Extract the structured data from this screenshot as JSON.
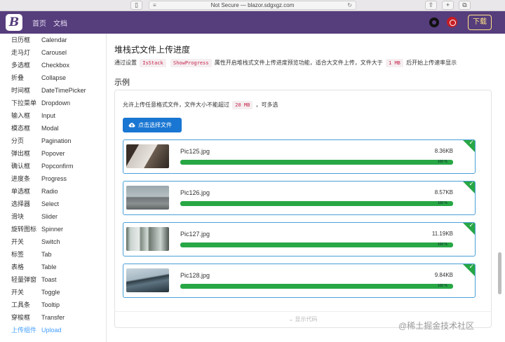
{
  "browser": {
    "url_text": "Not Secure — blazor.sdgxgz.com",
    "reload_glyph": "↻",
    "menu_glyph": "≡"
  },
  "header": {
    "logo_letter": "B",
    "nav": [
      "首页",
      "文档"
    ],
    "download_label": "下载"
  },
  "sidebar": {
    "items": [
      {
        "zh": "日历框",
        "en": "Calendar"
      },
      {
        "zh": "走马灯",
        "en": "Carousel"
      },
      {
        "zh": "多选框",
        "en": "Checkbox"
      },
      {
        "zh": "折叠",
        "en": "Collapse"
      },
      {
        "zh": "时间框",
        "en": "DateTimePicker"
      },
      {
        "zh": "下拉菜单",
        "en": "Dropdown"
      },
      {
        "zh": "输入框",
        "en": "Input"
      },
      {
        "zh": "模态框",
        "en": "Modal"
      },
      {
        "zh": "分页",
        "en": "Pagination"
      },
      {
        "zh": "弹出框",
        "en": "Popover"
      },
      {
        "zh": "确认框",
        "en": "Popconfirm"
      },
      {
        "zh": "进度条",
        "en": "Progress"
      },
      {
        "zh": "单选框",
        "en": "Radio"
      },
      {
        "zh": "选择器",
        "en": "Select"
      },
      {
        "zh": "滑块",
        "en": "Slider"
      },
      {
        "zh": "旋转图标",
        "en": "Spinner"
      },
      {
        "zh": "开关",
        "en": "Switch"
      },
      {
        "zh": "标签",
        "en": "Tab"
      },
      {
        "zh": "表格",
        "en": "Table"
      },
      {
        "zh": "轻量弹窗",
        "en": "Toast"
      },
      {
        "zh": "开关",
        "en": "Toggle"
      },
      {
        "zh": "工具条",
        "en": "Tooltip"
      },
      {
        "zh": "穿梭框",
        "en": "Transfer"
      },
      {
        "zh": "上传组件",
        "en": "Upload"
      }
    ],
    "active_index": 23
  },
  "main": {
    "title": "堆栈式文件上传进度",
    "desc_prefix": "通过设置",
    "code1": "IsStack",
    "code2": "ShowProgress",
    "desc_mid": "属性开启堆栈式文件上传进度预览功能，适合大文件上传，文件大于",
    "code3": "1 MB",
    "desc_suffix": "后开始上传速率显示",
    "section_title": "示例",
    "demo_desc_prefix": "允许上传任意格式文件，文件大小不能超过",
    "demo_code": "20 MB",
    "demo_desc_suffix": "，可多选",
    "upload_button": "点击选择文件",
    "show_code": "显示代码"
  },
  "files": [
    {
      "name": "Pic125.jpg",
      "size": "8.36KB",
      "progress": 100,
      "progress_text": "100 %",
      "thumb": "laptop"
    },
    {
      "name": "Pic126.jpg",
      "size": "8.57KB",
      "progress": 100,
      "progress_text": "100 %",
      "thumb": "pier"
    },
    {
      "name": "Pic127.jpg",
      "size": "11.19KB",
      "progress": 100,
      "progress_text": "100 %",
      "thumb": "window"
    },
    {
      "name": "Pic128.jpg",
      "size": "9.84KB",
      "progress": 100,
      "progress_text": "100 %",
      "thumb": "coast"
    }
  ],
  "watermark": "@稀土掘金技术社区",
  "colors": {
    "header_bg": "#563d7c",
    "active_link": "#409eff",
    "primary_button": "#1976d2",
    "progress_fill": "#28a745",
    "card_border": "#4a9fd8"
  }
}
